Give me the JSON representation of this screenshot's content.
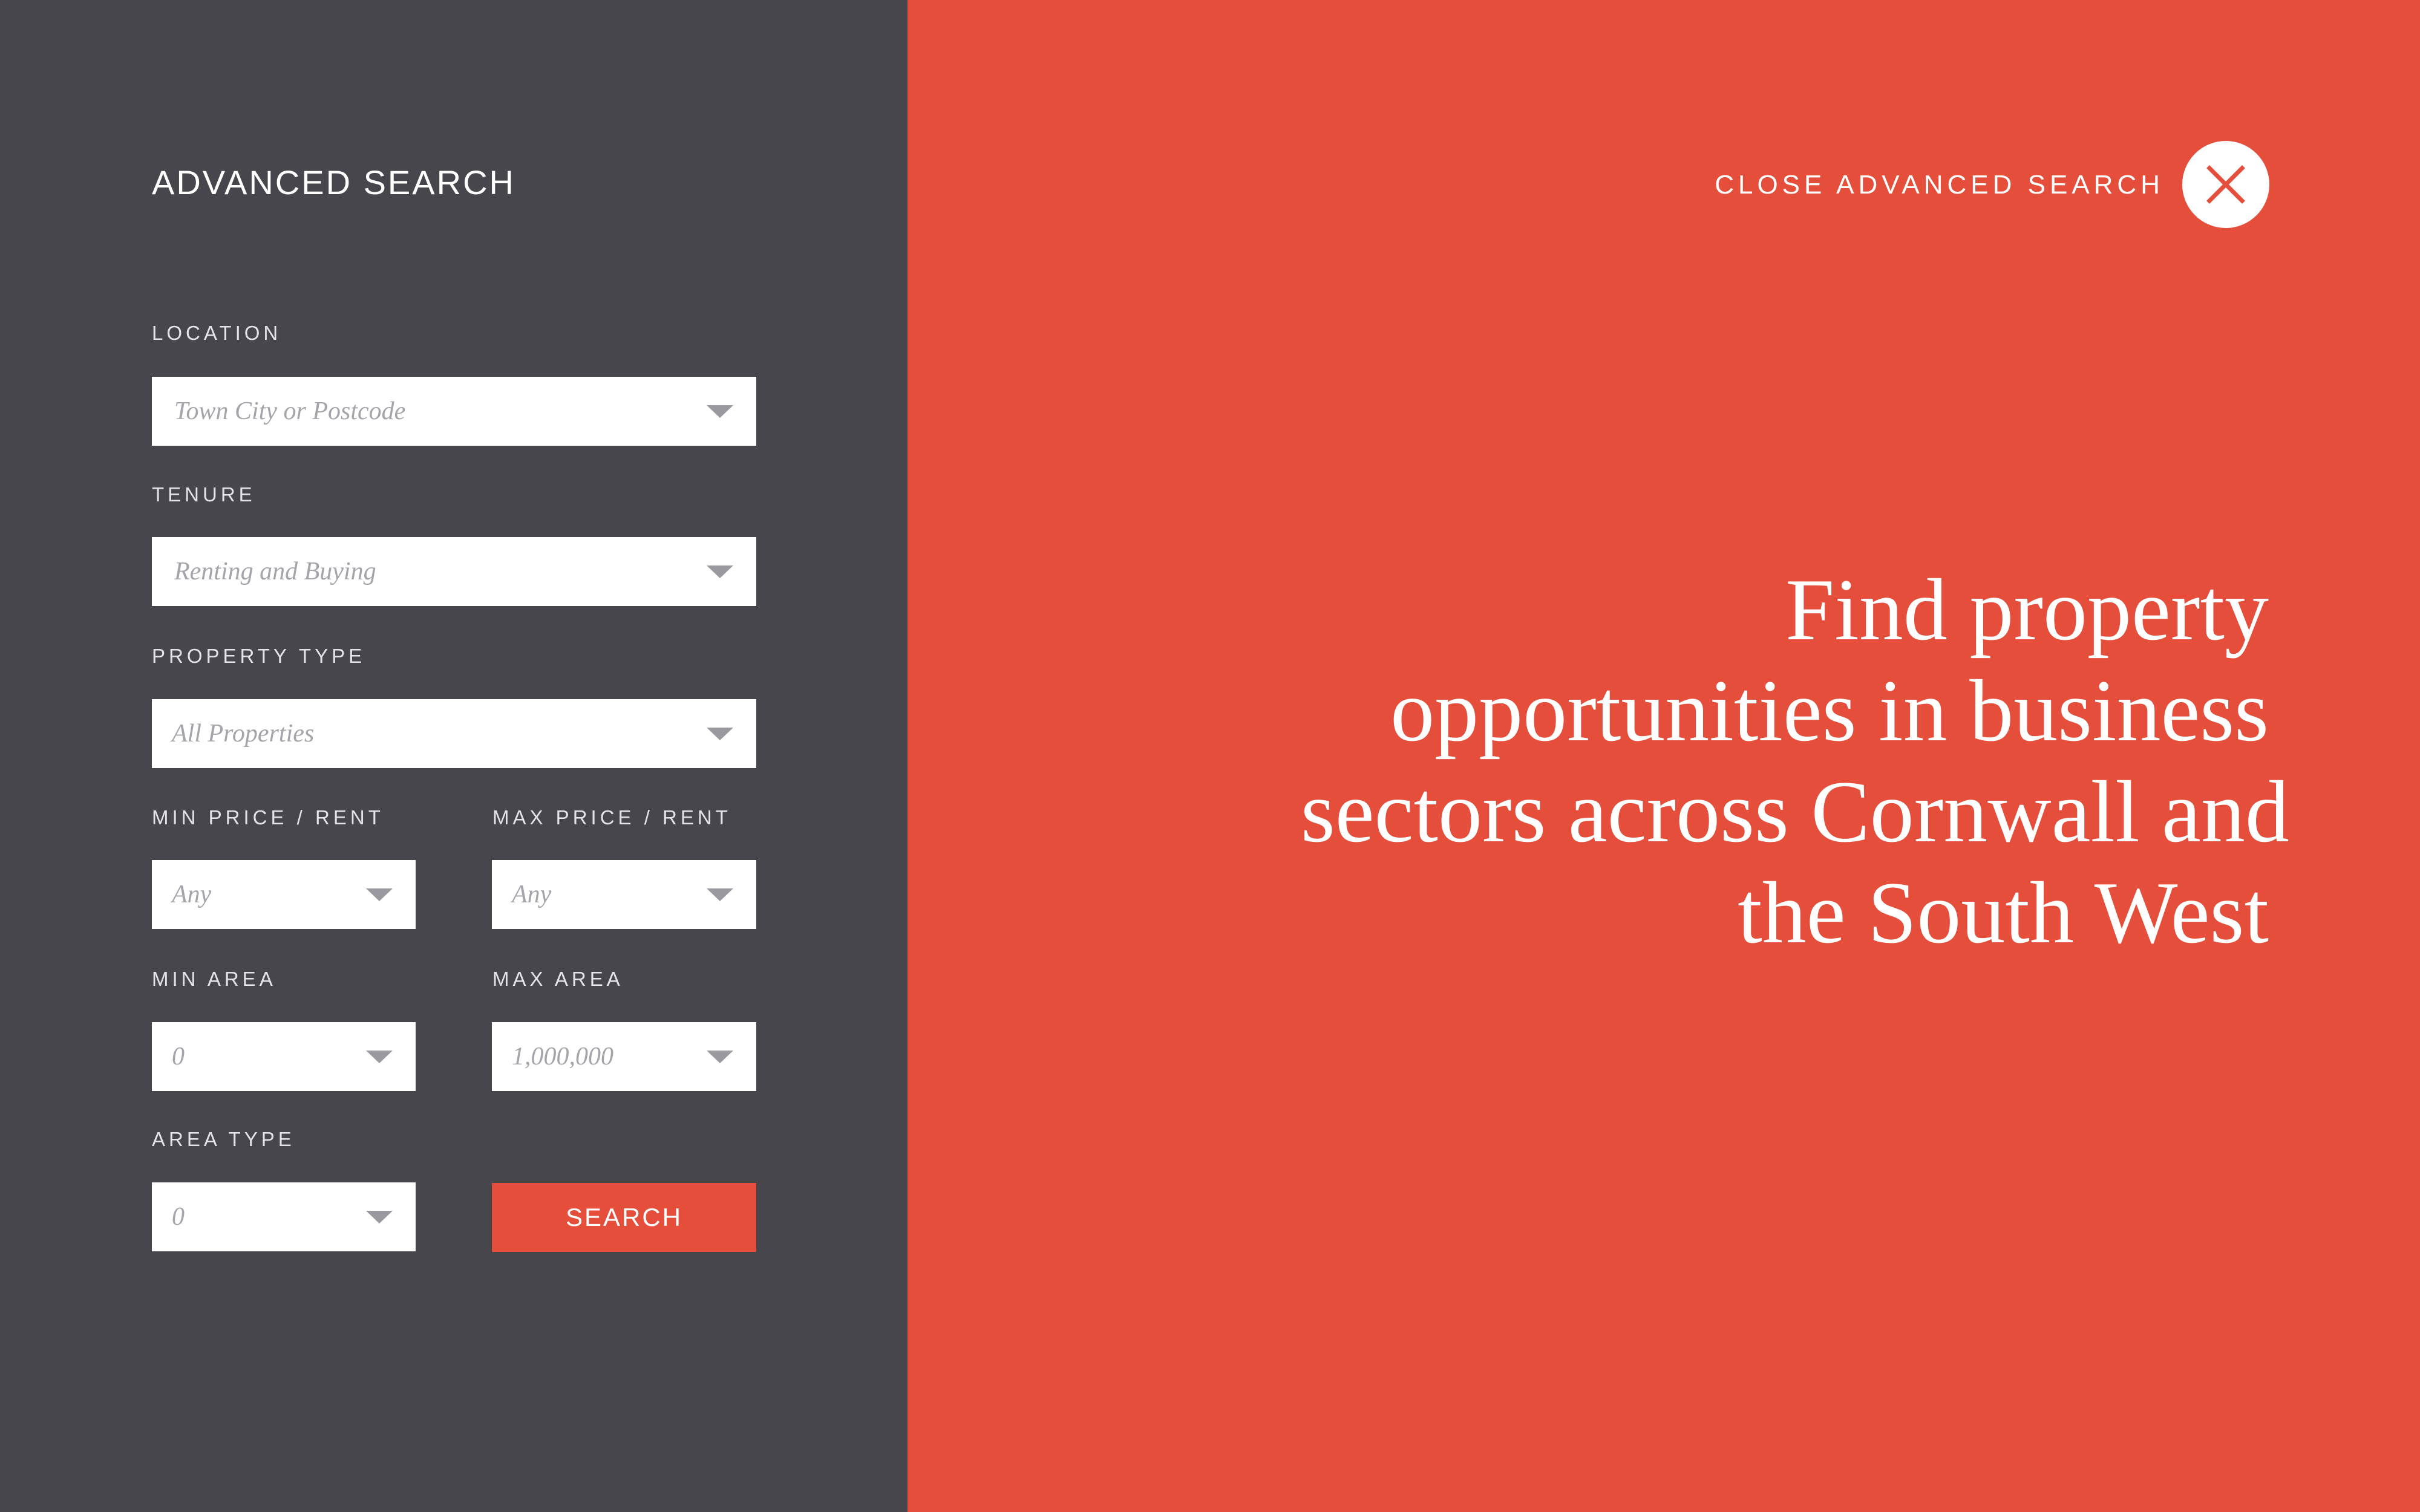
{
  "panel": {
    "title": "ADVANCED SEARCH"
  },
  "fields": {
    "location": {
      "label": "LOCATION",
      "value": "Town City or Postcode"
    },
    "tenure": {
      "label": "TENURE",
      "value": "Renting and Buying"
    },
    "property_type": {
      "label": "PROPERTY TYPE",
      "value": "All Properties"
    },
    "min_price": {
      "label": "MIN PRICE / RENT",
      "value": "Any"
    },
    "max_price": {
      "label": "MAX PRICE / RENT",
      "value": "Any"
    },
    "min_area": {
      "label": "MIN AREA",
      "value": "0"
    },
    "max_area": {
      "label": "MAX AREA",
      "value": "1,000,000"
    },
    "area_type": {
      "label": "AREA TYPE",
      "value": "0"
    }
  },
  "search_button": {
    "label": "SEARCH"
  },
  "close": {
    "label": "CLOSE ADVANCED SEARCH",
    "icon": "close-icon"
  },
  "headline": {
    "lines": [
      "Find property",
      "opportunities in business",
      "sectors across Cornwall and",
      "the South West"
    ]
  },
  "colors": {
    "panel_background": "#47464d",
    "accent": "#e44e3b",
    "field_background": "#ffffff",
    "placeholder_text": "#a5a4aa"
  },
  "icons": {
    "dropdown": "chevron-down-icon",
    "close": "close-icon"
  }
}
